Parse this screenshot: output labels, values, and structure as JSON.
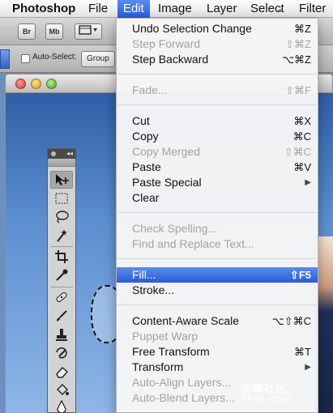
{
  "menubar": {
    "items": [
      "Photoshop",
      "File",
      "Edit",
      "Image",
      "Layer",
      "Select",
      "Filter"
    ],
    "active": "Edit"
  },
  "appbar": {
    "bridge": "Br",
    "minibridge": "Mb"
  },
  "options": {
    "auto_select_label": "Auto-Select:",
    "auto_select_value": "Group"
  },
  "edit_menu": {
    "items": [
      {
        "label": "Undo Selection Change",
        "shortcut": "⌘Z",
        "enabled": true
      },
      {
        "label": "Step Forward",
        "shortcut": "⇧⌘Z",
        "enabled": false
      },
      {
        "label": "Step Backward",
        "shortcut": "⌥⌘Z",
        "enabled": true
      },
      {
        "label": "Fade...",
        "shortcut": "⇧⌘F",
        "enabled": false
      },
      {
        "label": "Cut",
        "shortcut": "⌘X",
        "enabled": true
      },
      {
        "label": "Copy",
        "shortcut": "⌘C",
        "enabled": true
      },
      {
        "label": "Copy Merged",
        "shortcut": "⇧⌘C",
        "enabled": false
      },
      {
        "label": "Paste",
        "shortcut": "⌘V",
        "enabled": true
      },
      {
        "label": "Paste Special",
        "shortcut": "▶",
        "enabled": true
      },
      {
        "label": "Clear",
        "shortcut": "",
        "enabled": true
      },
      {
        "label": "Check Spelling...",
        "shortcut": "",
        "enabled": false
      },
      {
        "label": "Find and Replace Text...",
        "shortcut": "",
        "enabled": false
      },
      {
        "label": "Fill...",
        "shortcut": "⇧F5",
        "enabled": true,
        "highlighted": true
      },
      {
        "label": "Stroke...",
        "shortcut": "",
        "enabled": true
      },
      {
        "label": "Content-Aware Scale",
        "shortcut": "⌥⇧⌘C",
        "enabled": true
      },
      {
        "label": "Puppet Warp",
        "shortcut": "",
        "enabled": false
      },
      {
        "label": "Free Transform",
        "shortcut": "⌘T",
        "enabled": true
      },
      {
        "label": "Transform",
        "shortcut": "▶",
        "enabled": true
      },
      {
        "label": "Auto-Align Layers...",
        "shortcut": "",
        "enabled": false
      },
      {
        "label": "Auto-Blend Layers...",
        "shortcut": "",
        "enabled": false
      }
    ]
  },
  "tools": [
    "move-icon",
    "marquee-icon",
    "lasso-icon",
    "magic-wand-icon",
    "crop-icon",
    "eyedropper-icon",
    "healing-brush-icon",
    "brush-icon",
    "clone-stamp-icon",
    "history-brush-icon",
    "eraser-icon",
    "paint-bucket-icon",
    "blur-icon"
  ],
  "watermark": {
    "text": "朱峰社区",
    "site": "ZF3D.COM"
  },
  "colors": {
    "menu_highlight": "#2f62dc",
    "menubar_active": "#3a6be0"
  }
}
